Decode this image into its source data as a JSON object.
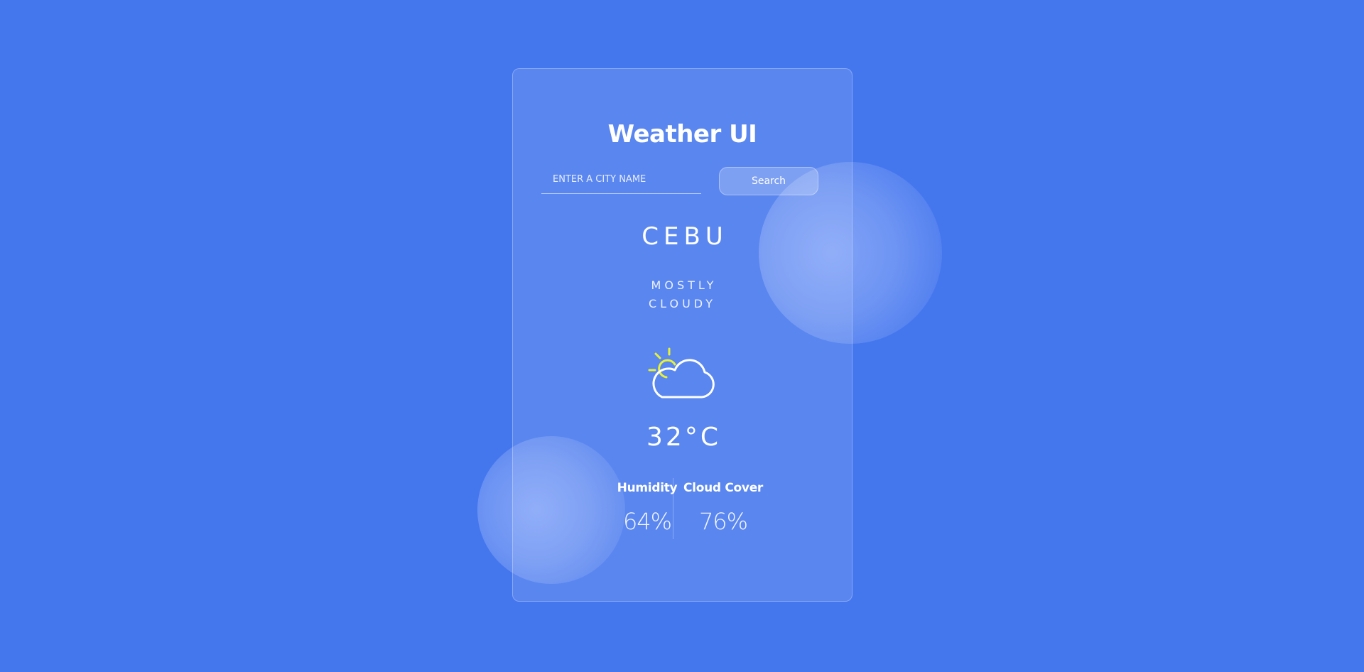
{
  "app": {
    "title": "Weather UI"
  },
  "search": {
    "placeholder": "ENTER A CITY NAME",
    "value": "",
    "button_label": "Search"
  },
  "weather": {
    "city": "CEBU",
    "condition": "MOSTLY CLOUDY",
    "icon": "partly-cloudy-icon",
    "temperature": "32°C"
  },
  "stats": {
    "humidity": {
      "label": "Humidity",
      "value": "64%"
    },
    "cloud_cover": {
      "label": "Cloud Cover",
      "value": "76%"
    }
  },
  "colors": {
    "background": "#4476ee",
    "sun": "#e8f232",
    "text": "#ffffff"
  }
}
